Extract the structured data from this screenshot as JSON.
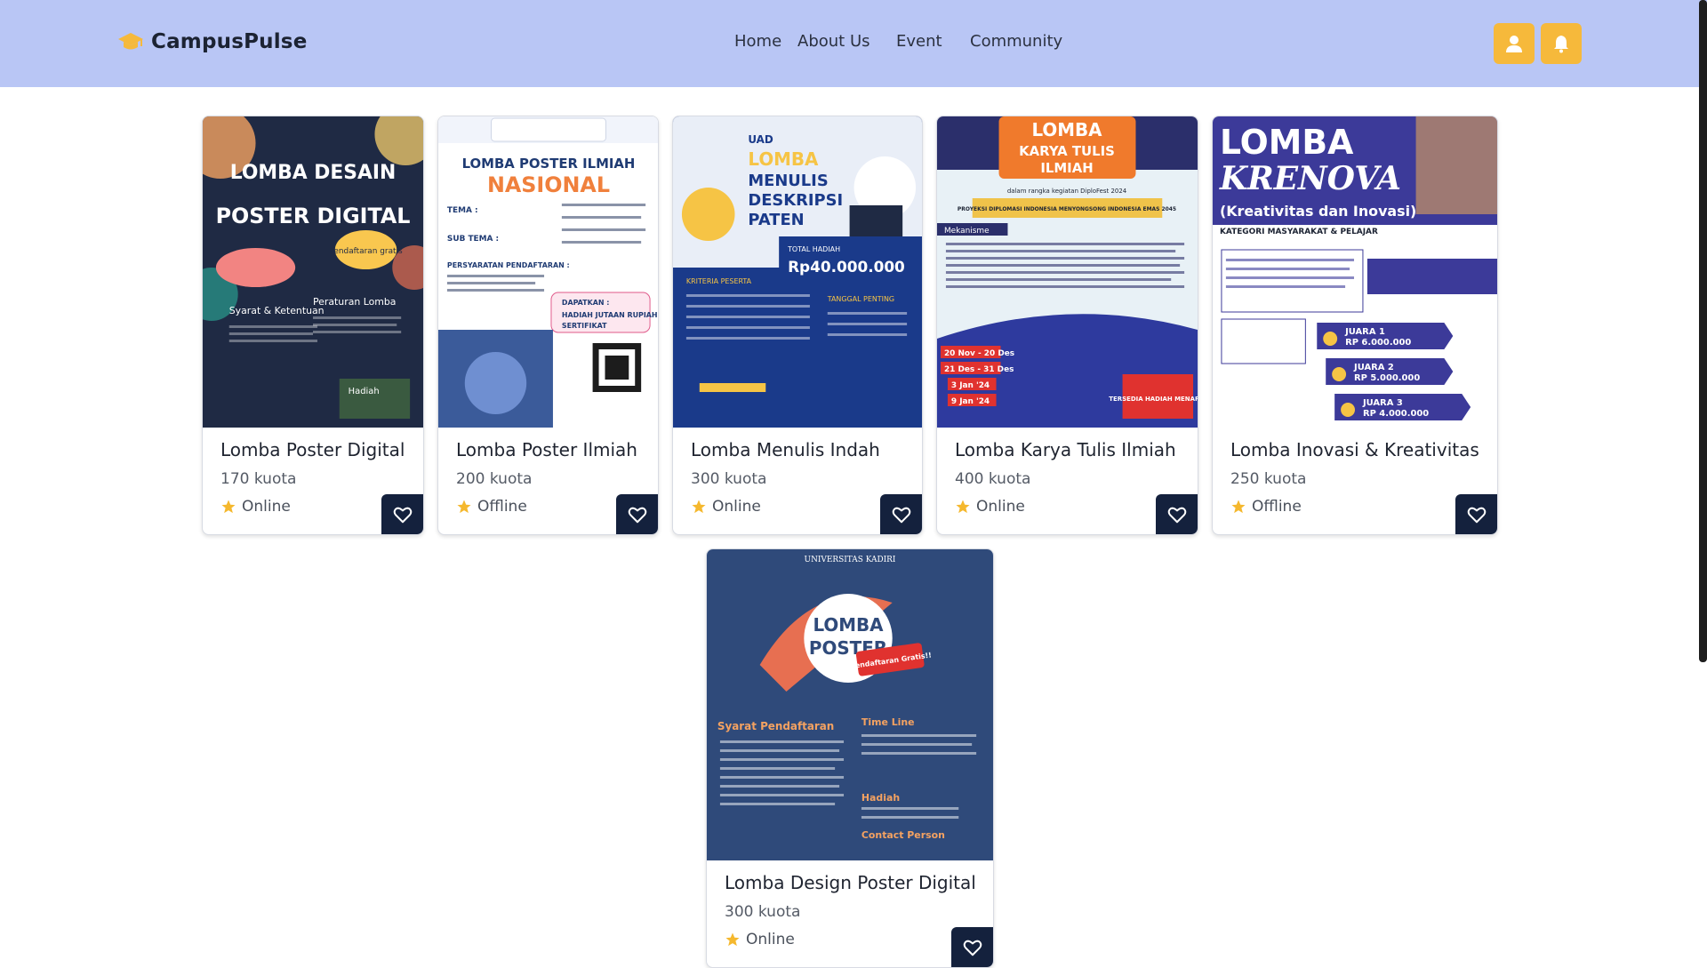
{
  "brand": {
    "name": "CampusPulse",
    "icon": "graduation-cap-icon"
  },
  "nav": {
    "links": [
      "Home",
      "About Us",
      "Event",
      "Community"
    ],
    "profile_icon": "user-icon",
    "notification_icon": "bell-icon"
  },
  "colors": {
    "navbar": "#b9c6f5",
    "accent": "#f6b93b",
    "fav_button": "#14213d",
    "star": "#f5b82e"
  },
  "cards": [
    {
      "title": "Lomba Poster Digital",
      "quota": "170 kuota",
      "mode": "Online",
      "poster": {
        "lines": [
          "LOMBA DESAIN",
          "POSTER DIGITAL",
          "Pendaftaran gratis",
          "Syarat & Ketentuan",
          "Peraturan Lomba",
          "Hadiah"
        ]
      }
    },
    {
      "title": "Lomba Poster Ilmiah",
      "quota": "200 kuota",
      "mode": "Offline",
      "poster": {
        "lines": [
          "LOMBA POSTER ILMIAH",
          "NASIONAL",
          "TEMA :",
          "SUB TEMA :",
          "PERSYARATAN PENDAFTARAN :",
          "DAPATKAN :",
          "HADIAH JUTAAN RUPIAH",
          "SERTIFIKAT"
        ]
      }
    },
    {
      "title": "Lomba Menulis Indah",
      "quota": "300 kuota",
      "mode": "Online",
      "poster": {
        "lines": [
          "UAD",
          "LOMBA",
          "MENULIS",
          "DESKRIPSI",
          "PATEN",
          "TOTAL HADIAH",
          "Rp40.000.000",
          "KRITERIA PESERTA",
          "TANGGAL PENTING"
        ]
      }
    },
    {
      "title": "Lomba Karya Tulis Ilmiah",
      "quota": "400 kuota",
      "mode": "Online",
      "poster": {
        "lines": [
          "LOMBA",
          "KARYA TULIS",
          "ILMIAH",
          "dalam rangka kegiatan DiploFest 2024",
          "PROYEKSI DIPLOMASI INDONESIA MENYONGSONG INDONESIA EMAS 2045",
          "Mekanisme",
          "20 Nov - 20 Des",
          "21 Des - 31 Des",
          "3 Jan '24",
          "9 Jan '24",
          "TERSEDIA HADIAH MENARIK"
        ]
      }
    },
    {
      "title": "Lomba Inovasi & Kreativitas",
      "quota": "250 kuota",
      "mode": "Offline",
      "poster": {
        "lines": [
          "LOMBA",
          "KRENOVA",
          "(Kreativitas dan Inovasi)",
          "KATEGORI MASYARAKAT & PELAJAR",
          "JUARA 1",
          "RP 6.000.000",
          "JUARA 2",
          "RP 5.000.000",
          "JUARA 3",
          "RP 4.000.000"
        ]
      }
    },
    {
      "title": "Lomba Design Poster Digital",
      "quota": "300 kuota",
      "mode": "Online",
      "poster": {
        "lines": [
          "UNIVERSITAS KADIRI",
          "LOMBA",
          "POSTER",
          "Pendaftaran Gratis!!",
          "Syarat Pendaftaran",
          "Time Line",
          "Hadiah",
          "Contact Person"
        ]
      }
    }
  ]
}
